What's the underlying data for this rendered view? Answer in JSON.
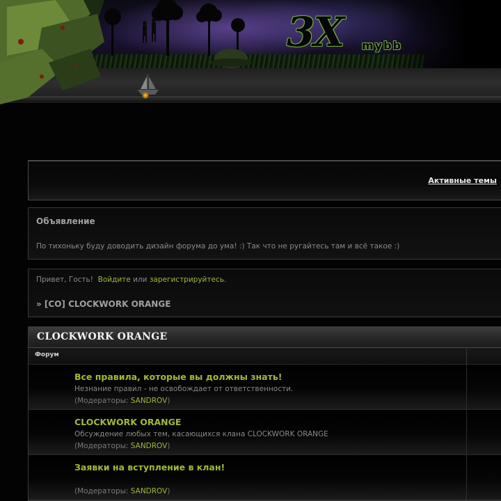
{
  "header": {
    "logo_main": "3X",
    "logo_sub": "mybb"
  },
  "active_topics": {
    "label": "Активные темы"
  },
  "announcement": {
    "title": "Объявление",
    "text": "По тихоньку буду доводить дизайн форума до ума! :) Так что не ругайтесь там и всё такое :)"
  },
  "welcome": {
    "greeting": "Привет, Гость!",
    "login_link": "Войдите",
    "or_text": "или",
    "register_link": "зарегистрируйтесь",
    "period": ".",
    "breadcrumb": "» [CO] CLOCKWORK ORANGE"
  },
  "category": {
    "title": "CLOCKWORK ORANGE",
    "column_forum": "Форум",
    "forums": [
      {
        "title": "Все правила, которые вы должны знать!",
        "description": "Незнание правил - не освобождает от ответственности.",
        "mods_prefix": "(Модераторы: ",
        "moderator": "SANDROV",
        "mods_suffix": ")"
      },
      {
        "title": "CLOCKWORK ORANGE",
        "description": "Обсуждение любых тем, касающихся клана CLOCKWORK ORANGE",
        "mods_prefix": "(Модераторы: ",
        "moderator": "SANDROV",
        "mods_suffix": ")"
      },
      {
        "title": "Заявки на вступление в клан!",
        "description": "",
        "mods_prefix": "(Модераторы: ",
        "moderator": "SANDROV",
        "mods_suffix": ")"
      }
    ]
  },
  "colors": {
    "accent_green": "#9fbc33",
    "link_green": "#9cb93d",
    "background": "#030303"
  },
  "icons": [
    "ship-icon",
    "camo-leaves-decoration",
    "soldier-silhouettes",
    "tree-silhouettes"
  ]
}
